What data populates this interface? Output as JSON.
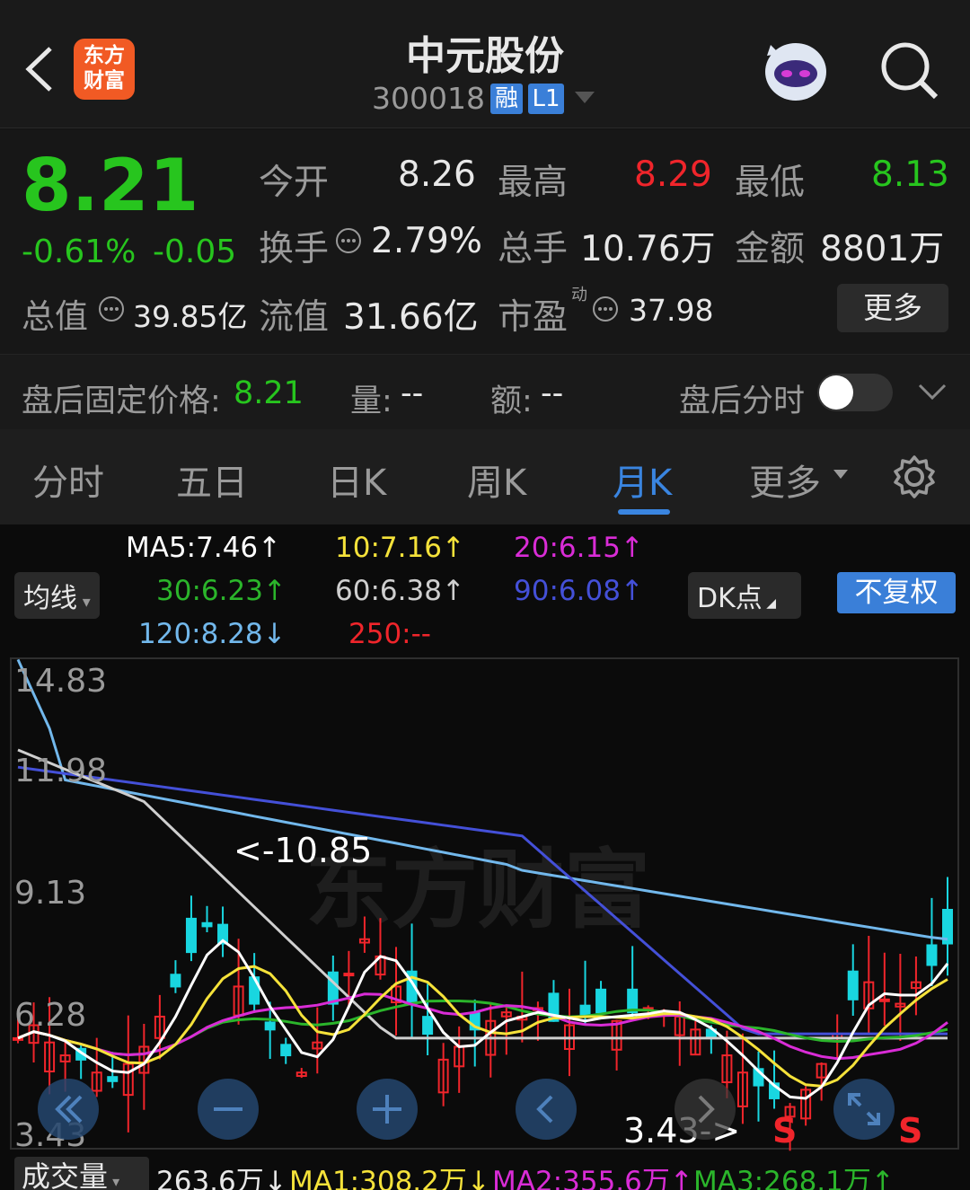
{
  "header": {
    "title": "中元股份",
    "code": "300018",
    "tag_rong": "融",
    "tag_level": "L1",
    "logo_line1": "东方",
    "logo_line2": "财富"
  },
  "quote": {
    "price": "8.21",
    "change_pct": "-0.61%",
    "change": "-0.05",
    "open_label": "今开",
    "open": "8.26",
    "high_label": "最高",
    "high": "8.29",
    "low_label": "最低",
    "low": "8.13",
    "turnover_label": "换手",
    "turnover": "2.79%",
    "volume_label": "总手",
    "volume": "10.76万",
    "amount_label": "金额",
    "amount": "8801万",
    "mcap_label": "总值",
    "mcap": "39.85亿",
    "float_label": "流值",
    "float": "31.66亿",
    "pe_label": "市盈",
    "pe_sup": "动",
    "pe": "37.98",
    "more_label": "更多"
  },
  "after_hours": {
    "label": "盘后固定价格:",
    "price": "8.21",
    "vol_label": "量:",
    "vol": "--",
    "amt_label": "额:",
    "amt": "--",
    "toggle_label": "盘后分时"
  },
  "tabs": {
    "t1": "分时",
    "t2": "五日",
    "t3": "日K",
    "t4": "周K",
    "t5": "月K",
    "t6": "更多"
  },
  "indicators": {
    "ma_button": "均线",
    "ma5": "MA5:7.46↑",
    "ma10": "10:7.16↑",
    "ma20": "20:6.15↑",
    "ma30": "30:6.23↑",
    "ma60": "60:6.38↑",
    "ma90": "90:6.08↑",
    "ma120": "120:8.28↓",
    "ma250": "250:--",
    "dk_label": "DK点",
    "fq_label": "不复权"
  },
  "chart": {
    "y1": "14.83",
    "y2": "11.98",
    "y3": "9.13",
    "y4": "6.28",
    "y5": "3.43",
    "high_mark": "<-10.85",
    "low_mark": "3.43->",
    "s1": "S",
    "s2": "S",
    "watermark": "东方财富"
  },
  "volume_bar": {
    "label": "成交量",
    "v": "263.6万↓",
    "ma1": "MA1:308.2万↓",
    "ma2": "MA2:355.6万↑",
    "ma3": "MA3:268.1万↑"
  },
  "colors": {
    "up": "#f0252b",
    "down": "#19d6e0",
    "ma5": "#ffffff",
    "ma10": "#f5e23a",
    "ma20": "#d92cd6",
    "ma30": "#2bb52b",
    "ma60": "#cfcfcf",
    "ma90": "#4450d8",
    "ma120": "#72b8ec",
    "accent": "#3a85e0"
  }
}
